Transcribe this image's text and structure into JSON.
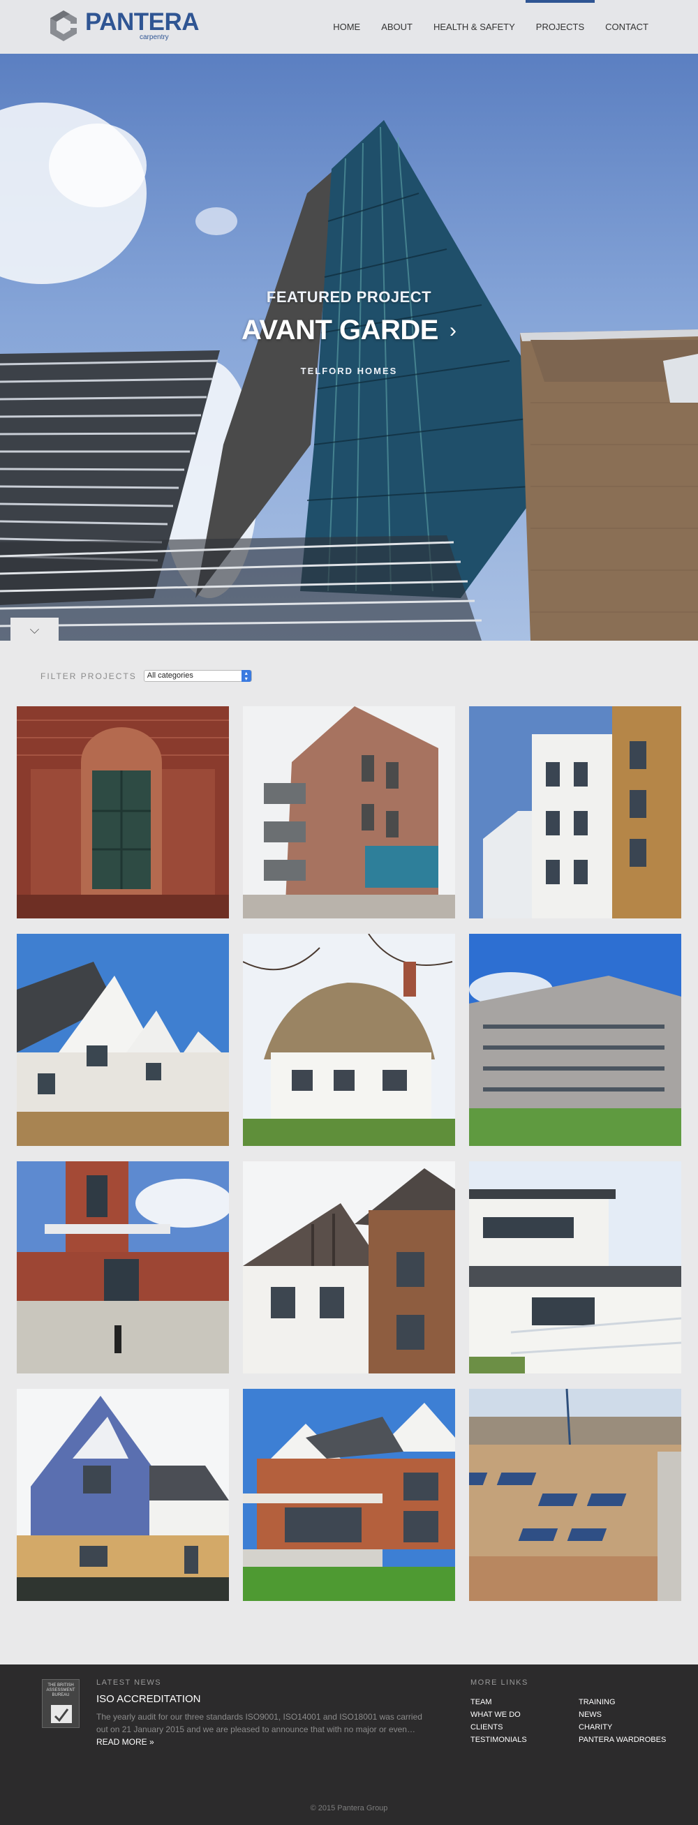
{
  "header": {
    "brand": "PANTERA",
    "brand_sub": "carpentry",
    "nav": [
      {
        "label": "HOME",
        "active": false
      },
      {
        "label": "ABOUT",
        "active": false
      },
      {
        "label": "HEALTH & SAFETY",
        "active": false
      },
      {
        "label": "PROJECTS",
        "active": true
      },
      {
        "label": "CONTACT",
        "active": false
      }
    ]
  },
  "hero": {
    "kicker": "FEATURED PROJECT",
    "title": "AVANT GARDE",
    "client": "TELFORD HOMES",
    "next_icon": "chevron-right-icon",
    "scroll_icon": "chevron-down-icon"
  },
  "filter": {
    "label": "FILTER PROJECTS",
    "selected": "All categories"
  },
  "projects": [
    {
      "name": "project-tile-1",
      "subject": "red brick doorway"
    },
    {
      "name": "project-tile-2",
      "subject": "brick apartment block"
    },
    {
      "name": "project-tile-3",
      "subject": "white and brick terrace"
    },
    {
      "name": "project-tile-4",
      "subject": "gabled houses"
    },
    {
      "name": "project-tile-5",
      "subject": "thatched cottage"
    },
    {
      "name": "project-tile-6",
      "subject": "modern apartments"
    },
    {
      "name": "project-tile-7",
      "subject": "art deco building"
    },
    {
      "name": "project-tile-8",
      "subject": "tudor style houses"
    },
    {
      "name": "project-tile-9",
      "subject": "white modern balconies"
    },
    {
      "name": "project-tile-10",
      "subject": "blue clad house"
    },
    {
      "name": "project-tile-11",
      "subject": "large brick villa"
    },
    {
      "name": "project-tile-12",
      "subject": "solar panel roofs"
    }
  ],
  "footer": {
    "badge_text": "THE BRITISH ASSESSMENT BUREAU",
    "news_kicker": "LATEST NEWS",
    "news_title": "ISO ACCREDITATION",
    "news_body": "The yearly audit for our three standards ISO9001, ISO14001 and ISO18001 was carried out on 21 January 2015 and we are pleased to announce that with no major or even… ",
    "news_more": "READ MORE »",
    "links_kicker": "MORE LINKS",
    "links": [
      "TEAM",
      "TRAINING",
      "WHAT WE DO",
      "NEWS",
      "CLIENTS",
      "CHARITY",
      "TESTIMONIALS",
      "PANTERA WARDROBES"
    ],
    "copyright": "© 2015 Pantera Group"
  },
  "colors": {
    "brand": "#2f5593",
    "header_bg": "#e5e6e9",
    "page_bg": "#e9e9ea",
    "footer_bg": "#2c2b2c"
  }
}
